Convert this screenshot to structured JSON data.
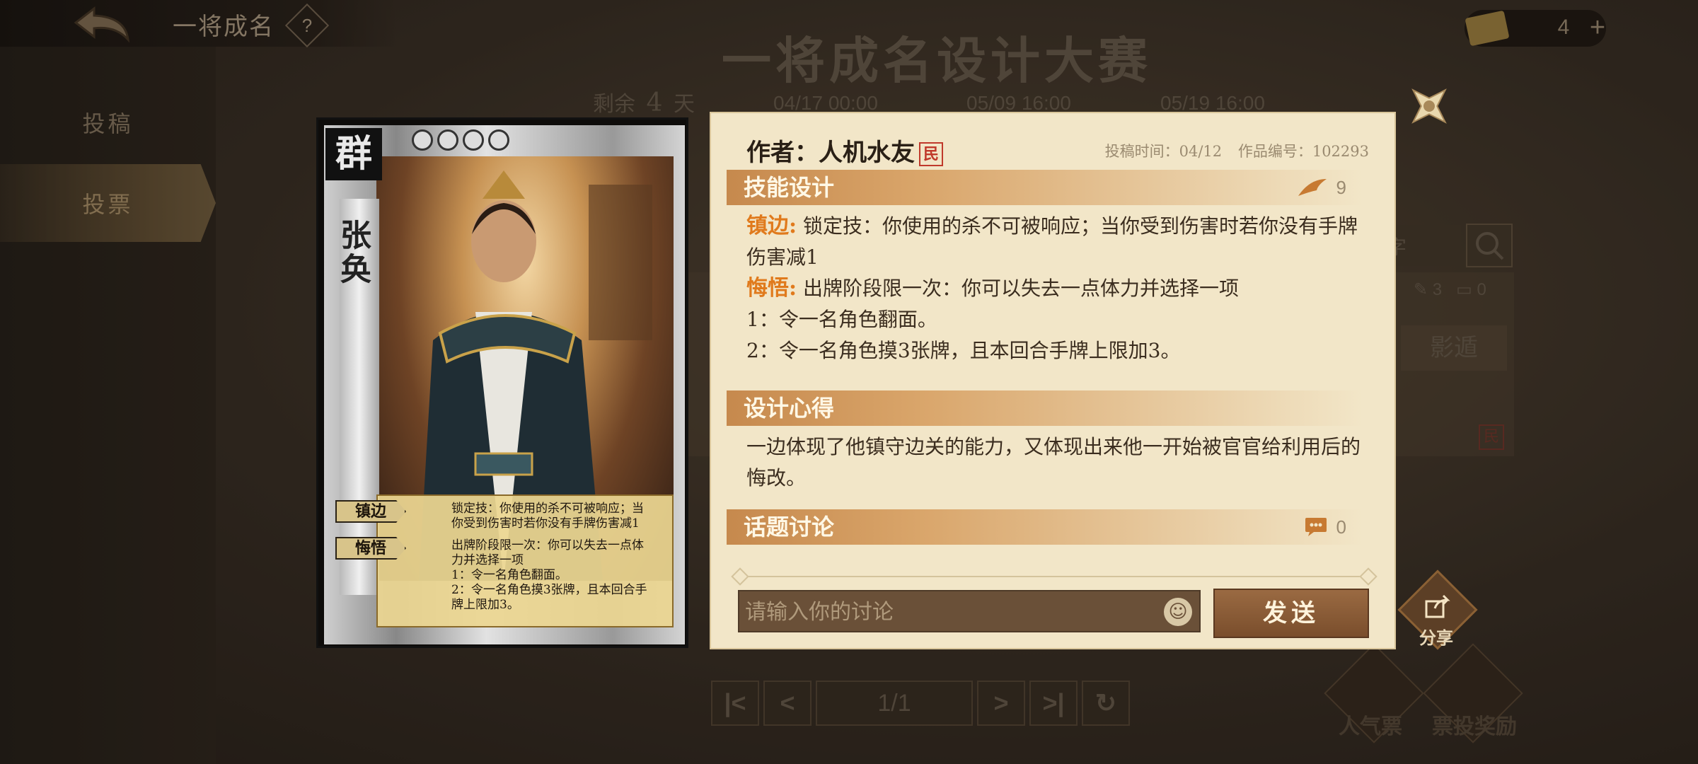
{
  "header": {
    "section_title": "一将成名",
    "help_label": "?",
    "main_title": "一将成名设计大赛",
    "remaining_label": "剩余",
    "remaining_days": "4",
    "remaining_unit": "天",
    "dates": [
      "04/17 00:00",
      "05/09 16:00",
      "05/19 16:00"
    ],
    "currency_count": "4",
    "currency_plus": "+"
  },
  "sidebar": {
    "items": [
      {
        "label": "投稿"
      },
      {
        "label": "投票"
      }
    ]
  },
  "background_list": {
    "search_text": "字",
    "likes": "3",
    "comments": "0",
    "entry_name": "影遁",
    "seal": "民"
  },
  "pager": {
    "page_label": "1/1"
  },
  "bottom": {
    "popularity_label": "人气票",
    "reward_label": "票投奖励",
    "share_label": "分享"
  },
  "card": {
    "faction": "群",
    "hp": 4,
    "name": "张奂",
    "skills": [
      {
        "tag": "镇边",
        "lines": [
          "锁定技：你使用的杀不可被响应；当",
          "你受到伤害时若你没有手牌伤害减1"
        ]
      },
      {
        "tag": "悔悟",
        "lines": [
          "出牌阶段限一次：你可以失去一点体",
          "力并选择一项",
          "1：令一名角色翻面。",
          "2：令一名角色摸3张牌，且本回合手",
          "牌上限加3。"
        ]
      }
    ]
  },
  "modal": {
    "author_label": "作者：",
    "author_name": "人机水友",
    "author_seal": "民",
    "submit_time": "投稿时间：04/12",
    "work_id": "作品编号：102293",
    "skill_section": {
      "title": "技能设计",
      "count": "9",
      "skills": [
        {
          "name": "镇边:",
          "desc": "锁定技：你使用的杀不可被响应；当你受到伤害时若你没有手牌伤害减1"
        },
        {
          "name": "悔悟:",
          "desc": "出牌阶段限一次：你可以失去一点体力并选择一项"
        }
      ],
      "options": [
        "1：令一名角色翻面。",
        "2：令一名角色摸3张牌，且本回合手牌上限加3。"
      ]
    },
    "design_section": {
      "title": "设计心得",
      "text": "一边体现了他镇守边关的能力，又体现出来他一开始被官官给利用后的悔改。"
    },
    "discussion_section": {
      "title": "话题讨论",
      "count": "0"
    },
    "input_placeholder": "请输入你的讨论",
    "send_label": "发送"
  },
  "colors": {
    "accent_orange": "#e07a1c",
    "section_header": "#c6894d",
    "panel_bg": "#f2e6c8",
    "send_button": "#7a4e2c"
  }
}
